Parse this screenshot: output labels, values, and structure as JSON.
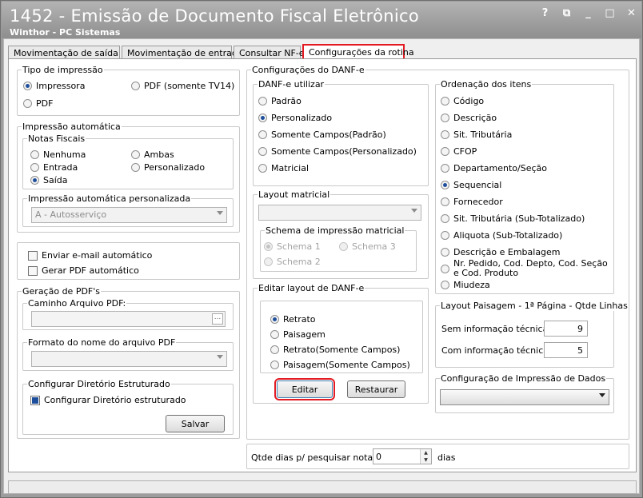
{
  "window": {
    "title": "1452 - Emissão de Documento Fiscal Eletrônico",
    "subtitle": "Winthor - PC Sistemas",
    "controls": [
      "?",
      "⧉",
      "_",
      "□",
      "✕"
    ]
  },
  "tabs": [
    "Movimentação de saída",
    "Movimentação de entrada",
    "Consultar NF-e",
    "Configurações da rotina"
  ],
  "tipo_impressao": {
    "title": "Tipo de impressão",
    "options": [
      "Impressora",
      "PDF (somente TV14)",
      "PDF"
    ],
    "selected": "Impressora"
  },
  "impressao_automatica": {
    "title": "Impressão automática",
    "notas_title": "Notas Fiscais",
    "options": [
      "Nenhuma",
      "Ambas",
      "Entrada",
      "Personalizado",
      "Saída"
    ],
    "selected": "Saída",
    "personalizada_title": "Impressão automática personalizada",
    "personalizada_value": "A - Autosserviço"
  },
  "email": {
    "enviar": "Enviar e-mail automático",
    "gerar": "Gerar PDF automático"
  },
  "pdfs": {
    "title": "Geração de PDF's",
    "caminho_title": "Caminho Arquivo PDF:",
    "formato_title": "Formato do nome do arquivo PDF",
    "estruturado_title": "Configurar Diretório Estruturado",
    "estruturado_cb": "Configurar Diretório estruturado",
    "salvar": "Salvar",
    "ellipsis": "..."
  },
  "danfe": {
    "title": "Configurações do DANF-e",
    "utilizar_title": "DANF-e utilizar",
    "utilizar_options": [
      "Padrão",
      "Personalizado",
      "Somente Campos(Padrão)",
      "Somente Campos(Personalizado)",
      "Matricial"
    ],
    "utilizar_selected": "Personalizado",
    "layout_matricial_title": "Layout matricial",
    "schema_title": "Schema de impressão matricial",
    "schema_options": [
      "Schema 1",
      "Schema 3",
      "Schema 2"
    ],
    "editar_title": "Editar layout de DANF-e",
    "editar_options": [
      "Retrato",
      "Paisagem",
      "Retrato(Somente Campos)",
      "Paisagem(Somente Campos)"
    ],
    "editar_selected": "Retrato",
    "btn_editar": "Editar",
    "btn_restaurar": "Restaurar"
  },
  "ordenacao": {
    "title": "Ordenação dos itens",
    "options": [
      "Código",
      "Descrição",
      "Sit. Tributária",
      "CFOP",
      "Departamento/Seção",
      "Sequencial",
      "Fornecedor",
      "Sit. Tributária (Sub-Totalizado)",
      "Aliquota (Sub-Totalizado)",
      "Descrição e Embalagem",
      "Nr. Pedido, Cod. Depto, Cod. Seção e Cod. Produto",
      "Miudeza"
    ],
    "selected": "Sequencial"
  },
  "paisagem": {
    "title": "Layout Paisagem - 1ª Página - Qtde Linhas",
    "sem_label": "Sem informação técnica",
    "sem_value": "9",
    "com_label": "Com informação técnica",
    "com_value": "5"
  },
  "config_impressao": {
    "title": "Configuração de Impressão de Dados"
  },
  "qtde_dias": {
    "label": "Qtde dias p/ pesquisar notas:",
    "value": "0",
    "unit": "dias"
  }
}
